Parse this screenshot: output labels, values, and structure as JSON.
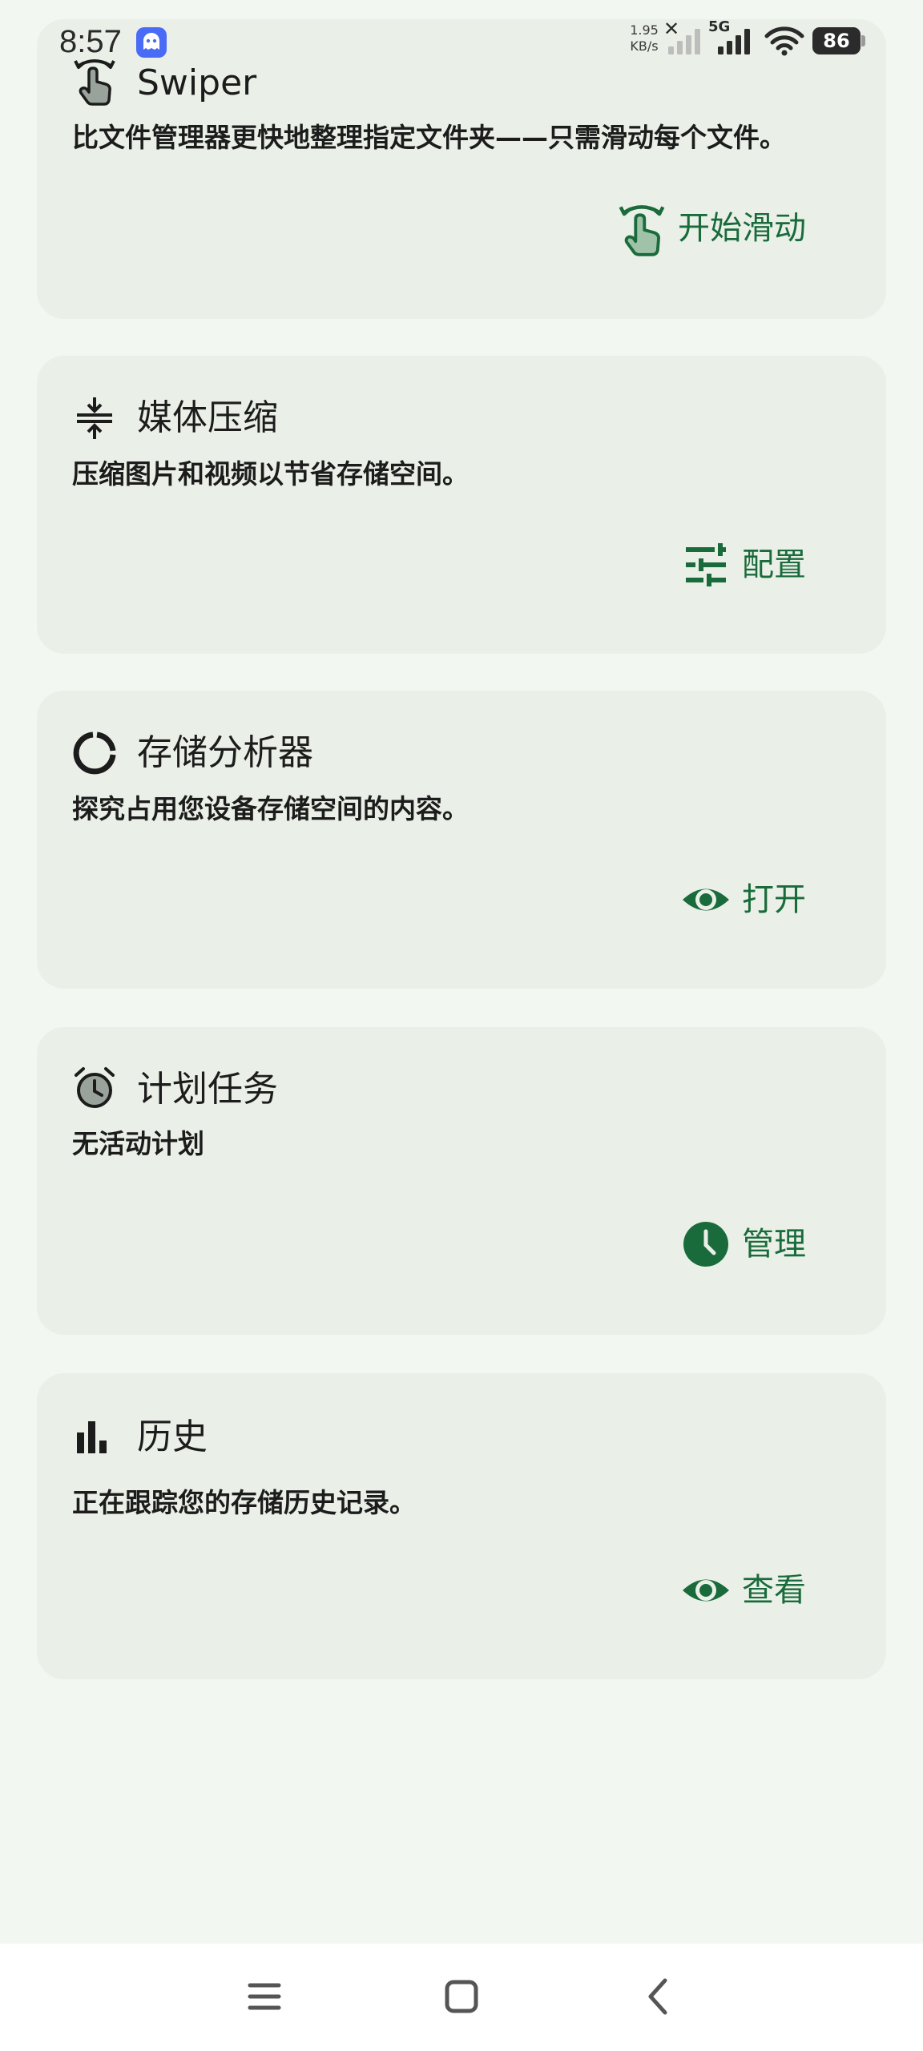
{
  "status_bar": {
    "time": "8:57",
    "net_speed_value": "1.95",
    "net_speed_unit": "KB/s",
    "network_type": "5G",
    "battery": "86"
  },
  "colors": {
    "background": "#f3f7f1",
    "card": "#eaf0e7",
    "accent": "#1a6b3c"
  },
  "cards": [
    {
      "icon": "swipe-hand-icon",
      "title": "Swiper",
      "description": "比文件管理器更快地整理指定文件夹——只需滑动每个文件。",
      "action_icon": "swipe-hand-icon",
      "action_label": "开始滑动"
    },
    {
      "icon": "compress-icon",
      "title": "媒体压缩",
      "description": "压缩图片和视频以节省存储空间。",
      "action_icon": "tune-icon",
      "action_label": "配置"
    },
    {
      "icon": "donut-chart-icon",
      "title": "存储分析器",
      "description": "探究占用您设备存储空间的内容。",
      "action_icon": "eye-icon",
      "action_label": "打开"
    },
    {
      "icon": "alarm-icon",
      "title": "计划任务",
      "description": "无活动计划",
      "action_icon": "clock-icon",
      "action_label": "管理"
    },
    {
      "icon": "bar-chart-icon",
      "title": "历史",
      "description": "正在跟踪您的存储历史记录。",
      "action_icon": "eye-icon",
      "action_label": "查看"
    }
  ],
  "nav_bar": {
    "buttons": [
      "menu-icon",
      "home-icon",
      "back-icon"
    ]
  }
}
